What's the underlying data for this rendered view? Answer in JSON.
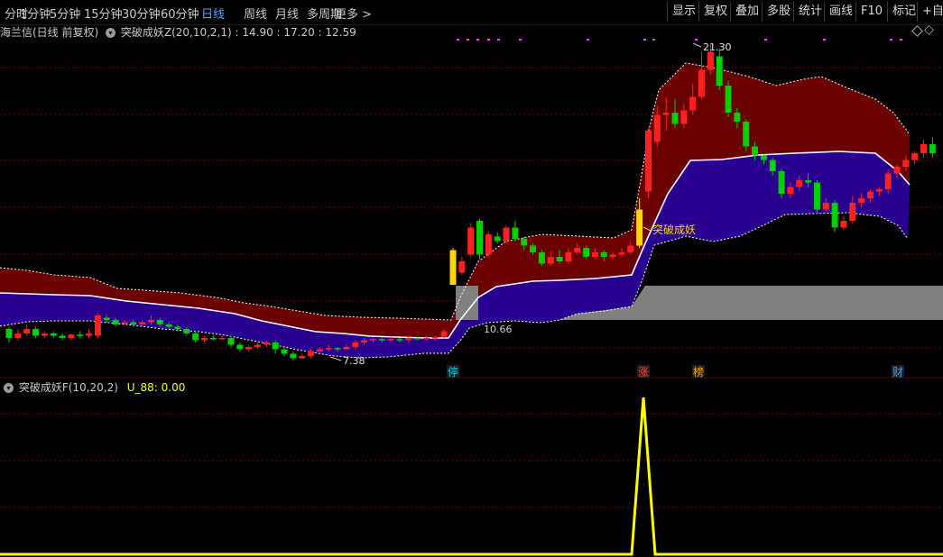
{
  "toolbar": {
    "periods": [
      "分时",
      "1分钟",
      "5分钟",
      "15分钟",
      "30分钟",
      "60分钟",
      "日线",
      "周线",
      "月线",
      "多周期",
      "更多 >"
    ],
    "active_period": "日线",
    "right_buttons": [
      "显示",
      "复权",
      "叠加",
      "多股",
      "统计",
      "画线",
      "F10",
      "标记",
      "+自选"
    ]
  },
  "main_info": {
    "stock": "海兰信(日线 前复权)",
    "indicator": "突破成妖Z(20,10,2,1)",
    "values": ": 14.90  : 17.20  : 12.59"
  },
  "annotations": {
    "high_label": "21.30",
    "low_label": "7.38",
    "mid_label": "10.66",
    "signal_label": "突破成妖",
    "markers": [
      "停",
      "涨",
      "榜",
      "财"
    ]
  },
  "lower_info": {
    "indicator": "突破成妖F(10,20,2)",
    "value": "U_88: 0.00"
  },
  "colors": {
    "up": "#ff2020",
    "down": "#00d000",
    "band_upper": "#6b0000",
    "band_lower": "#2a0090",
    "gray_block": "#808080",
    "signal": "#ffd700",
    "lower_line": "#ffff00",
    "grid": "#7a0000"
  },
  "chart_data": {
    "type": "candlestick",
    "price_range": [
      7.38,
      21.3
    ],
    "candles": [
      [
        8.7,
        8.3,
        8.8,
        8.1
      ],
      [
        8.3,
        8.5,
        8.7,
        8.2
      ],
      [
        8.5,
        8.7,
        8.9,
        8.4
      ],
      [
        8.7,
        8.4,
        8.8,
        8.3
      ],
      [
        8.4,
        8.5,
        8.6,
        8.3
      ],
      [
        8.5,
        8.4,
        8.6,
        8.3
      ],
      [
        8.4,
        8.3,
        8.5,
        8.2
      ],
      [
        8.3,
        8.45,
        8.5,
        8.2
      ],
      [
        8.45,
        8.4,
        8.6,
        8.3
      ],
      [
        8.4,
        8.5,
        8.7,
        8.3
      ],
      [
        8.4,
        9.3,
        9.4,
        8.3
      ],
      [
        9.2,
        9.1,
        9.3,
        9.0
      ],
      [
        9.1,
        8.9,
        9.2,
        8.8
      ],
      [
        8.95,
        9.0,
        9.1,
        8.9
      ],
      [
        9.0,
        8.9,
        9.1,
        8.8
      ],
      [
        8.9,
        9.0,
        9.1,
        8.85
      ],
      [
        9.0,
        9.1,
        9.3,
        8.9
      ],
      [
        9.1,
        8.9,
        9.2,
        8.8
      ],
      [
        8.9,
        8.8,
        9.0,
        8.7
      ],
      [
        8.8,
        8.7,
        8.9,
        8.6
      ],
      [
        8.7,
        8.5,
        8.8,
        8.4
      ],
      [
        8.5,
        8.2,
        8.6,
        8.1
      ],
      [
        8.2,
        8.3,
        8.4,
        8.1
      ],
      [
        8.3,
        8.25,
        8.4,
        8.2
      ],
      [
        8.25,
        8.3,
        8.4,
        8.2
      ],
      [
        8.3,
        8.0,
        8.4,
        7.9
      ],
      [
        8.0,
        7.8,
        8.1,
        7.7
      ],
      [
        7.8,
        7.9,
        8.0,
        7.7
      ],
      [
        7.9,
        8.0,
        8.1,
        7.8
      ],
      [
        8.0,
        8.1,
        8.2,
        7.9
      ],
      [
        8.1,
        7.8,
        8.2,
        7.6
      ],
      [
        7.8,
        7.6,
        7.9,
        7.5
      ],
      [
        7.6,
        7.4,
        7.7,
        7.3
      ],
      [
        7.4,
        7.5,
        7.6,
        7.38
      ],
      [
        7.5,
        7.7,
        7.8,
        7.4
      ],
      [
        7.7,
        7.8,
        7.9,
        7.6
      ],
      [
        7.8,
        7.85,
        8.0,
        7.7
      ],
      [
        7.85,
        7.8,
        7.9,
        7.7
      ],
      [
        7.8,
        7.9,
        8.0,
        7.75
      ],
      [
        7.9,
        8.1,
        8.2,
        7.8
      ],
      [
        8.1,
        8.2,
        8.3,
        8.0
      ],
      [
        8.2,
        8.25,
        8.3,
        8.1
      ],
      [
        8.25,
        8.2,
        8.3,
        8.1
      ],
      [
        8.2,
        8.25,
        8.35,
        8.1
      ],
      [
        8.25,
        8.2,
        8.3,
        8.1
      ],
      [
        8.2,
        8.3,
        8.4,
        8.1
      ],
      [
        8.3,
        8.25,
        8.35,
        8.2
      ],
      [
        8.25,
        8.3,
        8.4,
        8.2
      ],
      [
        8.3,
        8.35,
        8.4,
        8.2
      ],
      [
        8.35,
        8.6,
        8.7,
        8.3
      ],
      [
        10.66,
        12.2,
        12.3,
        10.66
      ],
      [
        11.2,
        11.7,
        11.9,
        11.1
      ],
      [
        12.0,
        13.2,
        13.4,
        11.9
      ],
      [
        13.5,
        12.0,
        13.6,
        11.8
      ],
      [
        12.0,
        12.9,
        13.0,
        11.9
      ],
      [
        12.8,
        12.6,
        13.0,
        12.5
      ],
      [
        12.6,
        13.2,
        13.3,
        12.5
      ],
      [
        13.2,
        12.7,
        13.5,
        12.6
      ],
      [
        12.7,
        12.4,
        12.8,
        12.2
      ],
      [
        12.4,
        12.1,
        12.5,
        12.0
      ],
      [
        12.1,
        11.6,
        12.2,
        11.5
      ],
      [
        11.6,
        11.9,
        12.1,
        11.5
      ],
      [
        11.9,
        11.7,
        12.2,
        11.6
      ],
      [
        11.7,
        12.1,
        12.3,
        11.6
      ],
      [
        12.1,
        12.3,
        12.5,
        12.0
      ],
      [
        12.3,
        11.9,
        12.4,
        11.8
      ],
      [
        11.9,
        12.1,
        12.3,
        11.8
      ],
      [
        12.1,
        11.9,
        12.2,
        11.7
      ],
      [
        11.9,
        12.0,
        12.1,
        11.8
      ],
      [
        12.0,
        12.1,
        12.3,
        11.9
      ],
      [
        12.1,
        12.4,
        12.6,
        12.0
      ],
      [
        12.4,
        14.0,
        14.5,
        12.3
      ],
      [
        14.8,
        17.5,
        17.6,
        14.5
      ],
      [
        17.0,
        18.2,
        18.6,
        16.8
      ],
      [
        18.2,
        18.3,
        19.0,
        17.5
      ],
      [
        18.3,
        17.8,
        18.9,
        17.6
      ],
      [
        17.8,
        18.4,
        18.7,
        17.6
      ],
      [
        18.4,
        19.0,
        19.6,
        18.2
      ],
      [
        19.0,
        20.2,
        21.0,
        18.9
      ],
      [
        20.2,
        21.0,
        21.3,
        20.0
      ],
      [
        20.8,
        19.5,
        21.1,
        19.3
      ],
      [
        19.5,
        18.3,
        19.7,
        18.1
      ],
      [
        18.3,
        17.9,
        18.5,
        17.6
      ],
      [
        17.9,
        16.8,
        18.0,
        16.6
      ],
      [
        16.8,
        16.4,
        17.0,
        16.2
      ],
      [
        16.4,
        16.2,
        16.5,
        16.0
      ],
      [
        16.2,
        15.7,
        16.3,
        15.5
      ],
      [
        15.7,
        14.7,
        15.8,
        14.5
      ],
      [
        14.7,
        15.0,
        15.2,
        14.5
      ],
      [
        15.0,
        15.3,
        15.5,
        14.8
      ],
      [
        15.3,
        15.2,
        15.6,
        15.0
      ],
      [
        15.2,
        14.0,
        15.3,
        13.8
      ],
      [
        14.0,
        14.3,
        14.5,
        13.9
      ],
      [
        14.3,
        13.2,
        14.4,
        13.0
      ],
      [
        13.2,
        13.5,
        13.7,
        13.1
      ],
      [
        13.5,
        14.3,
        14.6,
        13.4
      ],
      [
        14.3,
        14.5,
        14.7,
        14.1
      ],
      [
        14.5,
        14.8,
        14.9,
        14.3
      ],
      [
        14.8,
        14.9,
        15.0,
        14.6
      ],
      [
        14.9,
        15.6,
        15.8,
        14.7
      ],
      [
        15.6,
        15.9,
        16.0,
        15.4
      ],
      [
        15.9,
        16.2,
        16.4,
        15.7
      ],
      [
        16.2,
        16.5,
        16.6,
        16.0
      ],
      [
        16.5,
        16.9,
        17.1,
        16.3
      ],
      [
        16.9,
        16.5,
        17.2,
        16.3
      ]
    ],
    "lower_series": {
      "name": "U_88",
      "values": [
        0,
        1,
        0
      ]
    }
  }
}
